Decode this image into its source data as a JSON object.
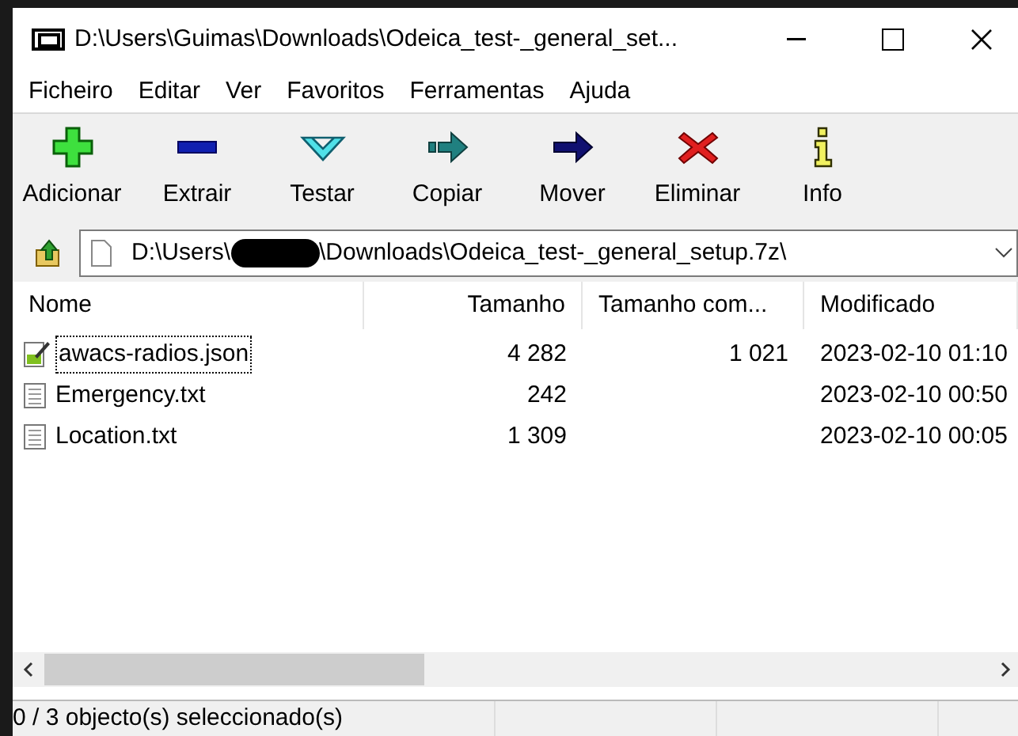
{
  "window": {
    "title": "D:\\Users\\Guimas\\Downloads\\Odeica_test-_general_set..."
  },
  "menu": [
    "Ficheiro",
    "Editar",
    "Ver",
    "Favoritos",
    "Ferramentas",
    "Ajuda"
  ],
  "toolbar": [
    {
      "kind": "add",
      "label": "Adicionar"
    },
    {
      "kind": "extract",
      "label": "Extrair"
    },
    {
      "kind": "test",
      "label": "Testar"
    },
    {
      "kind": "copy",
      "label": "Copiar"
    },
    {
      "kind": "move",
      "label": "Mover"
    },
    {
      "kind": "delete",
      "label": "Eliminar"
    },
    {
      "kind": "info",
      "label": "Info"
    }
  ],
  "address": {
    "path_start": "D:\\Users\\",
    "path_end": "\\Downloads\\Odeica_test-_general_setup.7z\\"
  },
  "table": {
    "columns": [
      "Nome",
      "Tamanho",
      "Tamanho com...",
      "Modificado"
    ],
    "rows": [
      {
        "kind": "json",
        "focused": true,
        "cells": [
          "awacs-radios.json",
          "4 282",
          "1 021",
          "2023-02-10 01:10"
        ]
      },
      {
        "kind": "text",
        "focused": false,
        "cells": [
          "Emergency.txt",
          "242",
          "",
          "2023-02-10 00:50"
        ]
      },
      {
        "kind": "text",
        "focused": false,
        "cells": [
          "Location.txt",
          "1 309",
          "",
          "2023-02-10 00:05"
        ]
      }
    ]
  },
  "status_bar": "0 / 3 objecto(s) seleccionado(s)"
}
